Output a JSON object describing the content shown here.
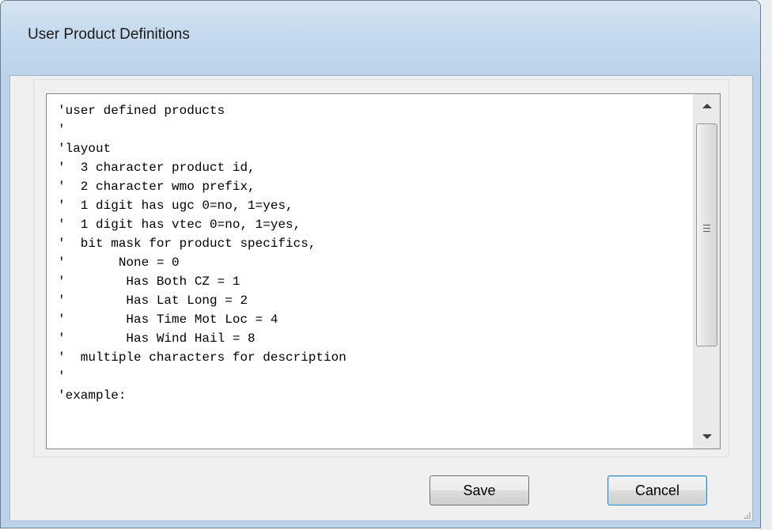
{
  "window": {
    "title": "User Product Definitions"
  },
  "editor": {
    "lines": [
      "'user defined products",
      "'",
      "'layout",
      "'  3 character product id,",
      "'  2 character wmo prefix,",
      "'  1 digit has ugc 0=no, 1=yes,",
      "'  1 digit has vtec 0=no, 1=yes,",
      "'  bit mask for product specifics,",
      "'       None = 0",
      "'        Has Both CZ = 1",
      "'        Has Lat Long = 2",
      "'        Has Time Mot Loc = 4",
      "'        Has Wind Hail = 8",
      "'  multiple characters for description",
      "'",
      "'example:"
    ]
  },
  "buttons": {
    "save_label": "Save",
    "cancel_label": "Cancel"
  },
  "icons": {
    "scroll_up": "scroll-up-arrow-icon",
    "scroll_down": "scroll-down-arrow-icon",
    "resize": "resize-grip-icon"
  }
}
